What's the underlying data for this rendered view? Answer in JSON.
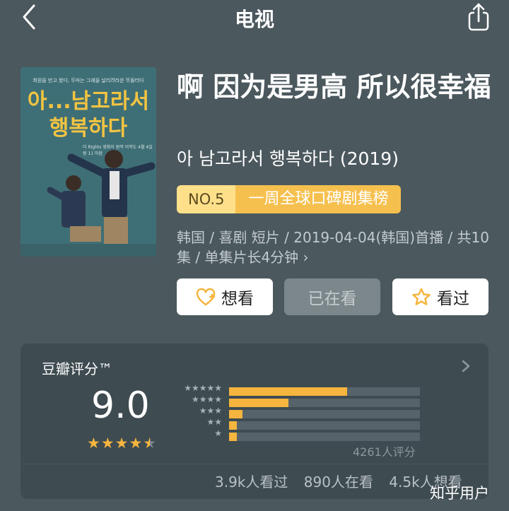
{
  "header": {
    "title": "电视",
    "back_icon": "chevron-left-icon",
    "share_icon": "share-icon"
  },
  "poster": {
    "top_text": "회원을 만고 왔다, 두마는 그래을 날리려라운 뚜돌터다",
    "title_line1": "아...남고라서",
    "title_line2": "행복하다",
    "small_text": "더 Rights 영화이 원작 이작도 4월 4일 원 11 마음",
    "bg_color": "#3f6f76",
    "title_color": "#f3c441"
  },
  "info": {
    "cn_title": "啊 因为是男高 所以很幸福",
    "original_title": "아 남고라서 행복하다 (2019)",
    "rank_no": "NO.5",
    "rank_text": "一周全球口碑剧集榜",
    "meta": "韩国 / 喜剧 短片 / 2019-04-04(韩国)首播 / 共10集 / 单集片长4分钟 ›"
  },
  "actions": {
    "want_label": "想看",
    "watching_label": "已在看",
    "watched_label": "看过"
  },
  "rating": {
    "title": "豆瓣评分™",
    "score": "9.0",
    "star_value": 4.5,
    "distribution": [
      {
        "stars": "★★★★★",
        "fraction": 0.62
      },
      {
        "stars": "★★★★",
        "fraction": 0.31
      },
      {
        "stars": "★★★",
        "fraction": 0.07
      },
      {
        "stars": "★★",
        "fraction": 0.03
      },
      {
        "stars": "★",
        "fraction": 0.03
      }
    ],
    "count": "4261人评分",
    "watched": "3.9k人看过",
    "watching": "890人在看",
    "want": "4.5k人想看"
  },
  "colors": {
    "background": "#4b585e",
    "accent": "#f6b53e",
    "rank_bg": "#f6c04f"
  },
  "watermark": "知乎用户"
}
